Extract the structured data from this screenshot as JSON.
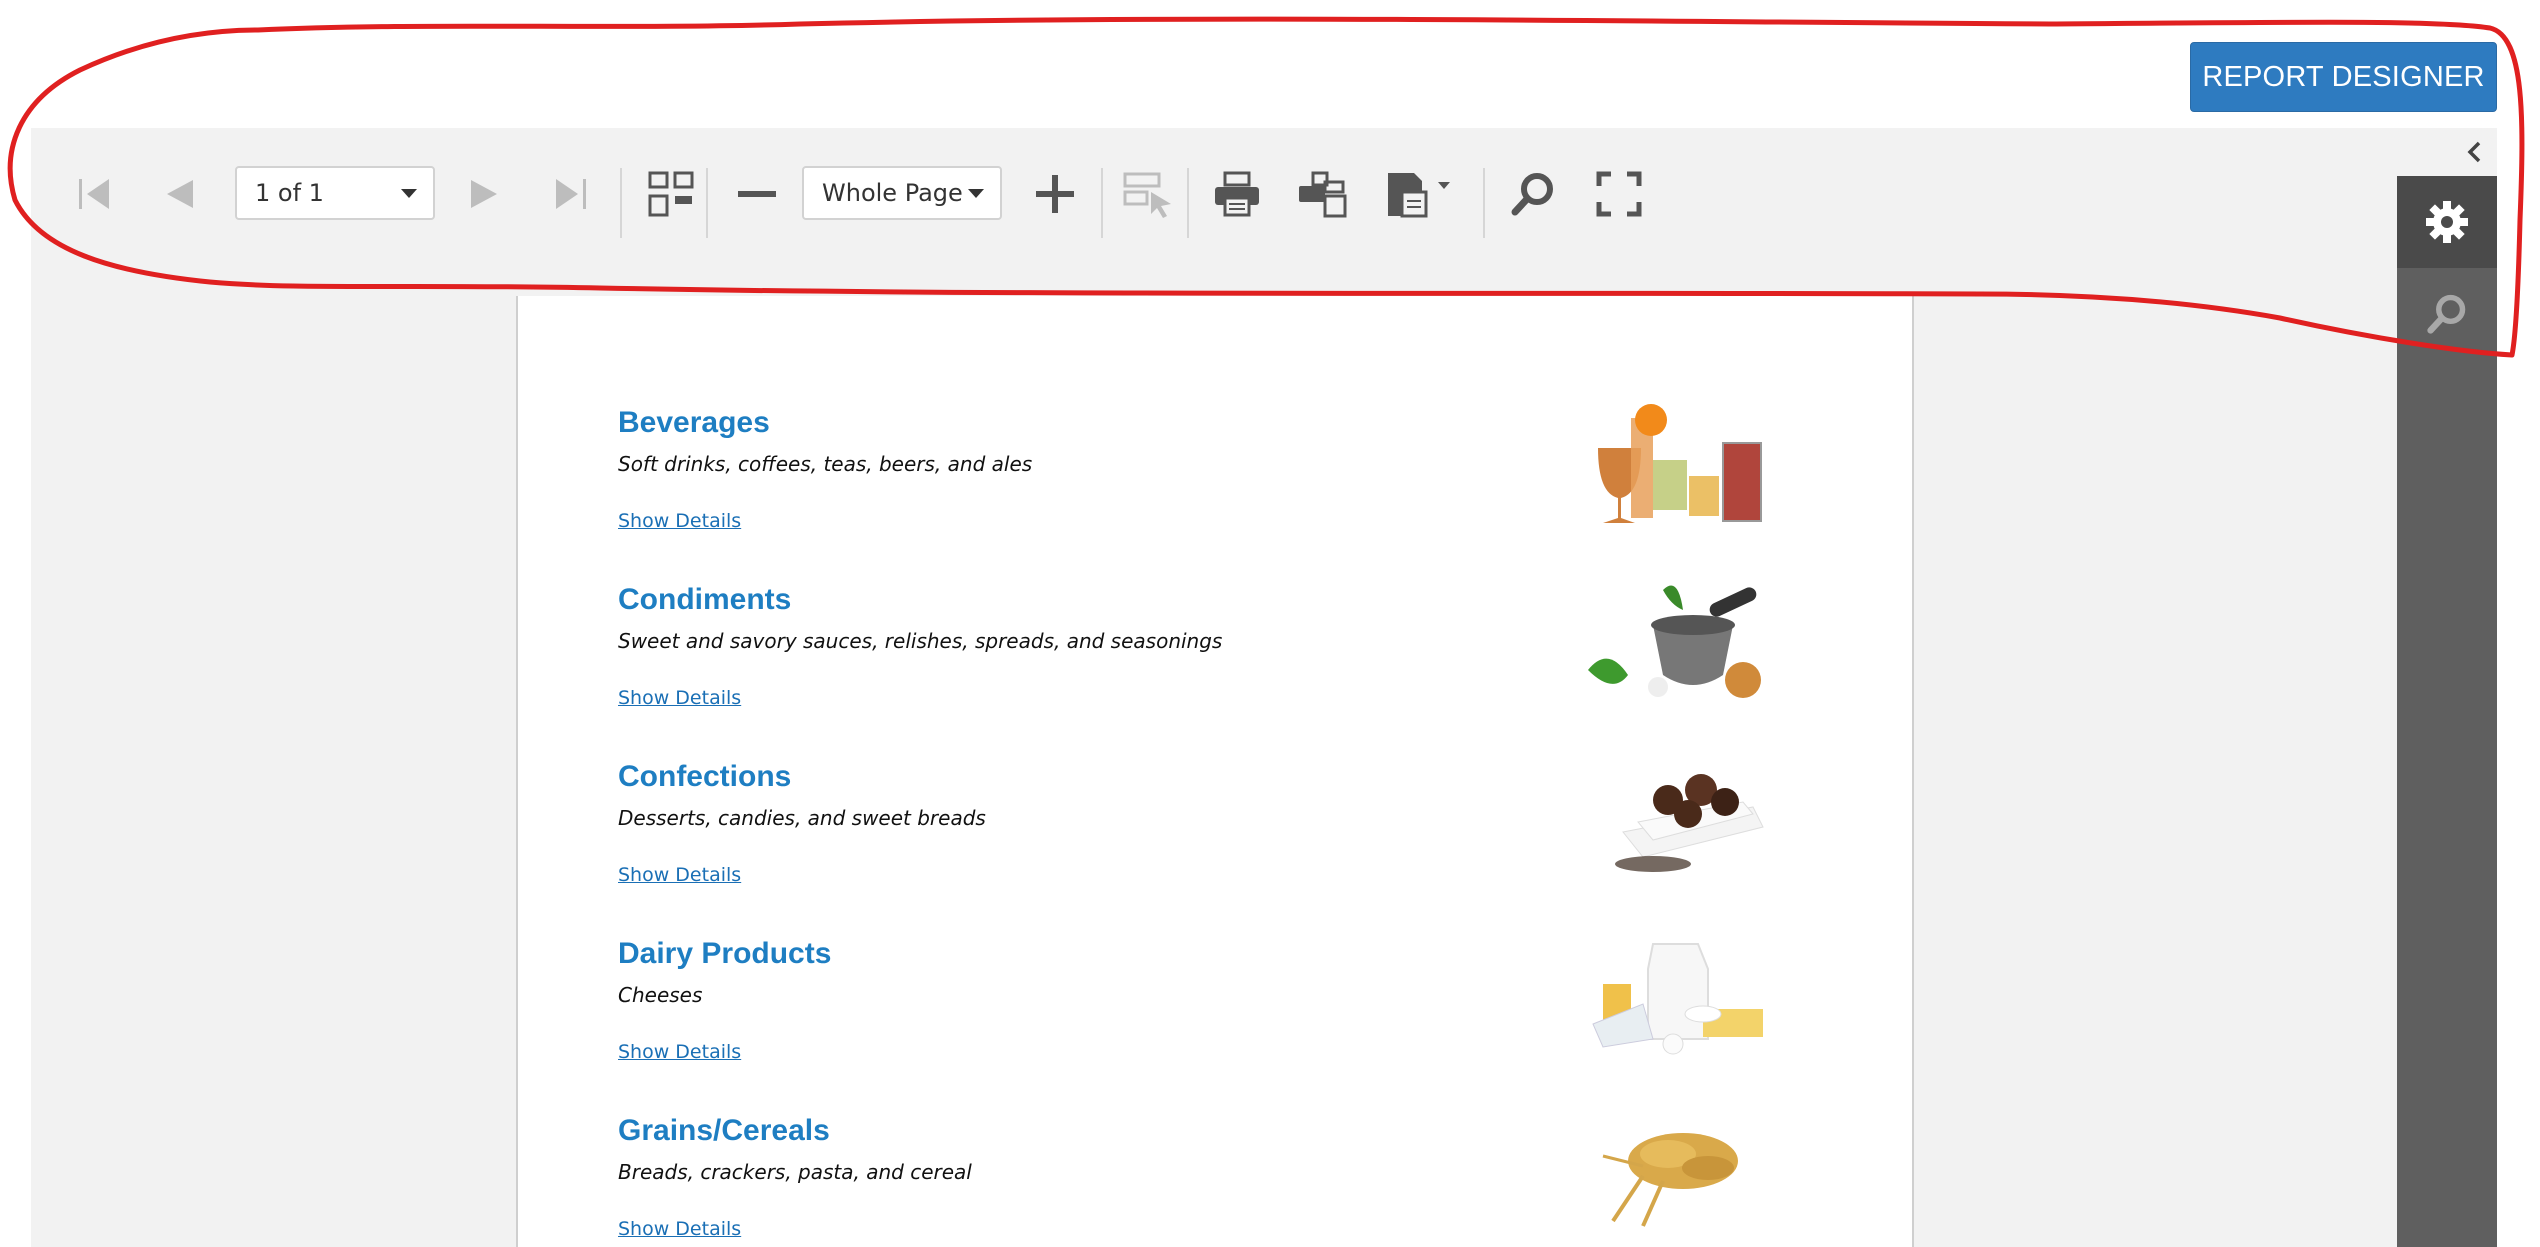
{
  "header": {
    "designer_button": "REPORT DESIGNER"
  },
  "toolbar": {
    "page_selector": "1 of 1",
    "zoom_selector": "Whole Page",
    "icons": [
      "first-page-icon",
      "prev-page-icon",
      "next-page-icon",
      "last-page-icon",
      "multipage-icon",
      "zoom-out-icon",
      "zoom-in-icon",
      "highlight-editing-fields-icon",
      "print-icon",
      "print-page-icon",
      "export-icon",
      "search-icon",
      "full-screen-icon"
    ]
  },
  "right_panel": {
    "icons": [
      "collapse-chevron-icon",
      "settings-gear-icon",
      "search-icon"
    ]
  },
  "report": {
    "categories": [
      {
        "name": "Beverages",
        "description": "Soft drinks, coffees, teas, beers, and ales",
        "link": "Show Details",
        "image": "beverages-photo"
      },
      {
        "name": "Condiments",
        "description": "Sweet and savory sauces, relishes, spreads, and seasonings",
        "link": "Show Details",
        "image": "condiments-photo"
      },
      {
        "name": "Confections",
        "description": "Desserts, candies, and sweet breads",
        "link": "Show Details",
        "image": "confections-photo"
      },
      {
        "name": "Dairy Products",
        "description": "Cheeses",
        "link": "Show Details",
        "image": "dairy-photo"
      },
      {
        "name": "Grains/Cereals",
        "description": "Breads, crackers, pasta, and cereal",
        "link": "Show Details",
        "image": "grains-photo"
      }
    ]
  },
  "colors": {
    "accent": "#2e7bc0",
    "category_title": "#1e7ec2",
    "annotation": "#e02020",
    "panel_dark": "#5f5f5f"
  }
}
